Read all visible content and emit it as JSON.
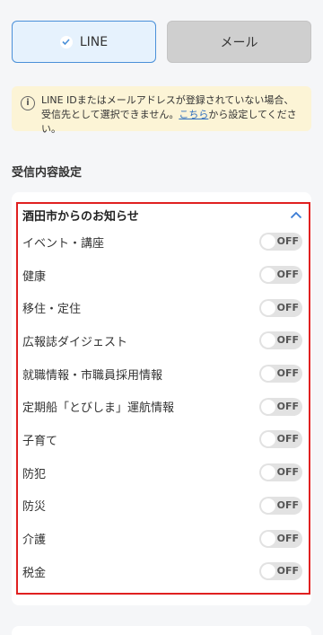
{
  "channels": {
    "line_label": "LINE",
    "mail_label": "メール",
    "selected": "line"
  },
  "notice": {
    "text_before": "LINE IDまたはメールアドレスが登録されていない場合、受信先として選択できません。",
    "link_text": "こちら",
    "text_after": "から設定してください。",
    "icon": "info-icon"
  },
  "section": {
    "title": "受信内容設定"
  },
  "category": {
    "title": "酒田市からのお知らせ",
    "expanded": true,
    "items": [
      {
        "label": "イベント・講座",
        "state": "OFF"
      },
      {
        "label": "健康",
        "state": "OFF"
      },
      {
        "label": "移住・定住",
        "state": "OFF"
      },
      {
        "label": "広報誌ダイジェスト",
        "state": "OFF"
      },
      {
        "label": "就職情報・市職員採用情報",
        "state": "OFF"
      },
      {
        "label": "定期船「とびしま」運航情報",
        "state": "OFF"
      },
      {
        "label": "子育て",
        "state": "OFF"
      },
      {
        "label": "防犯",
        "state": "OFF"
      },
      {
        "label": "防災",
        "state": "OFF"
      },
      {
        "label": "介護",
        "state": "OFF"
      },
      {
        "label": "税金",
        "state": "OFF"
      }
    ]
  },
  "colors": {
    "accent": "#4a90d9",
    "highlight": "#e02020",
    "notice_bg": "#fcf4d6"
  }
}
